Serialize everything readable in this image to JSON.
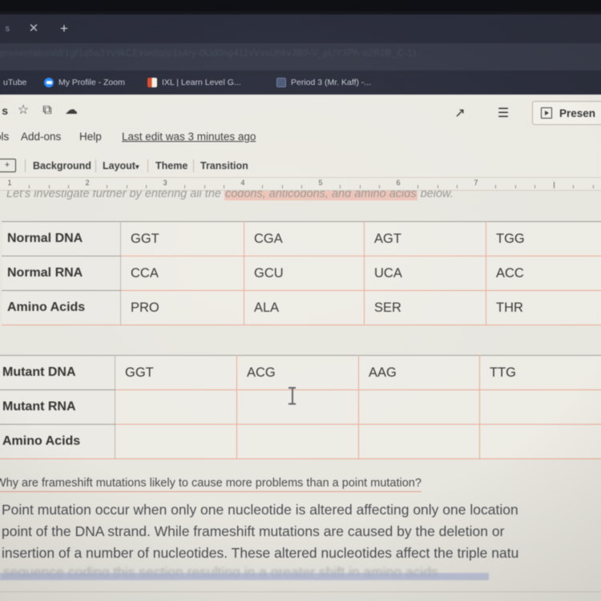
{
  "browser": {
    "tab_partial_label": "s",
    "close_icon": "close-icon",
    "new_tab_icon": "new-tab-icon",
    "url_text": "presentation/d/1gf1q5a3Yv9kCEkwdtqIp1s4ry-0Ud0ng411vVvsUhkvJB0-V_pUY3Ph-a2R2B_C-1)",
    "bookmarks": [
      {
        "label": "uTube",
        "icon": "youtube-icon"
      },
      {
        "label": "My Profile - Zoom",
        "icon": "zoom-icon"
      },
      {
        "label": "IXL | Learn Level G...",
        "icon": "ixl-icon"
      },
      {
        "label": "Period 3 (Mr. Kaff) -...",
        "icon": "classroom-doc-icon"
      }
    ]
  },
  "app": {
    "title_tail": "s",
    "quick_icons": [
      {
        "name": "star-icon",
        "glyph": "☆"
      },
      {
        "name": "move-to-folder-icon",
        "glyph": "⧉"
      },
      {
        "name": "cloud-saved-icon",
        "glyph": "☁"
      }
    ],
    "menus": [
      {
        "label": "ols"
      },
      {
        "label": "Add-ons"
      },
      {
        "label": "Help"
      }
    ],
    "last_edit": "Last edit was 3 minutes ago",
    "toolbar_right": [
      {
        "name": "activity-dashboard-icon",
        "glyph": "↗"
      },
      {
        "name": "comment-history-icon",
        "glyph": "☰"
      }
    ],
    "present_button": {
      "label": "Presen",
      "icon": "present-play-icon"
    },
    "slide_toolbar": {
      "new_slide_icon": "new-slide-icon",
      "new_slide_glyph": "+",
      "buttons": [
        {
          "label": "Background",
          "caret": false
        },
        {
          "label": "Layout",
          "caret": true
        },
        {
          "label": "Theme",
          "caret": false
        },
        {
          "label": "Transition",
          "caret": false
        }
      ],
      "caret_glyph": "▾"
    },
    "ruler": {
      "numbers": [
        "1",
        "2",
        "3",
        "4",
        "5",
        "6",
        "7"
      ]
    }
  },
  "slide": {
    "intro_text_before": "Let's investigate further by entering all the ",
    "intro_text_highlight": "codons, anticodons, and amino acids",
    "intro_text_after": " below.",
    "highlight_color": "#f0a594",
    "table_border_color": "#e8a88f",
    "table_normal": {
      "rows": [
        {
          "header": "Normal DNA",
          "cells": [
            "GGT",
            "CGA",
            "AGT",
            "TGG"
          ]
        },
        {
          "header": "Normal RNA",
          "cells": [
            "CCA",
            "GCU",
            "UCA",
            "ACC"
          ]
        },
        {
          "header": "Amino Acids",
          "cells": [
            "PRO",
            "ALA",
            "SER",
            "THR"
          ]
        }
      ]
    },
    "table_mutant": {
      "rows": [
        {
          "header": "Mutant DNA",
          "cells": [
            "GGT",
            "ACG",
            "AAG",
            "TTG"
          ]
        },
        {
          "header": "Mutant RNA",
          "cells": [
            "",
            "",
            "",
            ""
          ]
        },
        {
          "header": "Amino Acids",
          "cells": [
            "",
            "",
            "",
            ""
          ]
        }
      ]
    },
    "question": "Why are frameshift mutations likely to cause more problems than a point mutation?",
    "answer_lines": [
      "Point mutation occur when only one nucleotide is altered affecting only one location",
      "point of the DNA strand. While frameshift mutations are caused by the deletion or",
      "insertion of a number of nucleotides. These altered nucleotides affect the triple natu"
    ],
    "answer_line_obscured": "sequence coding this section resulting in a greater shift in amino acids",
    "cursor": "text-ibeam-cursor"
  }
}
